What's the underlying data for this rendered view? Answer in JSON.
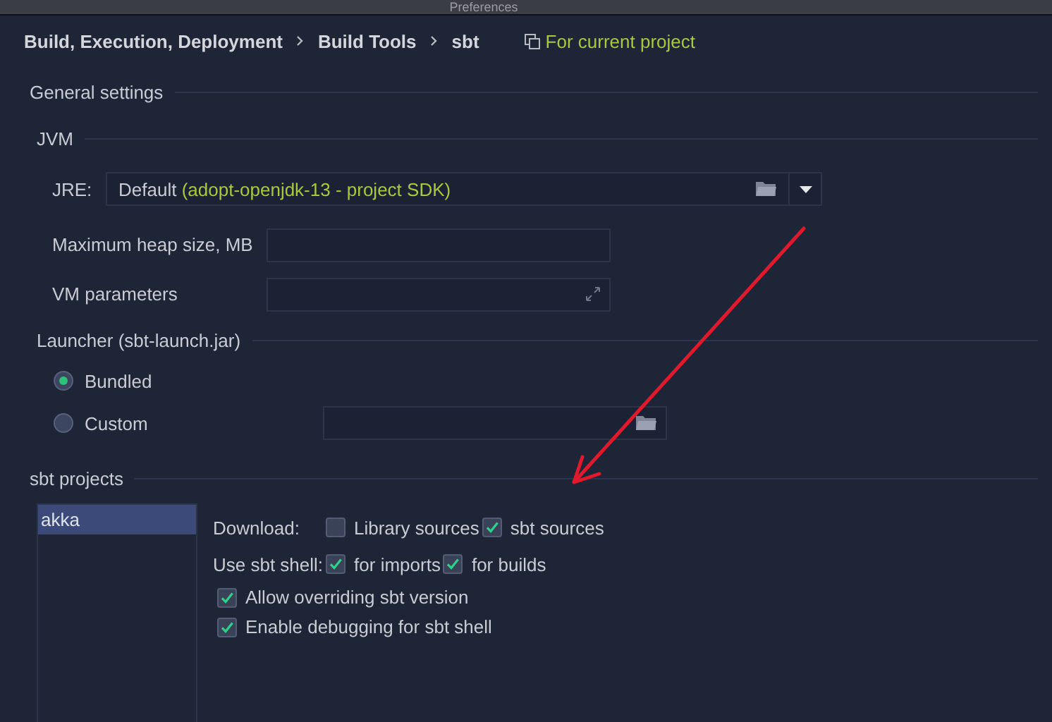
{
  "window": {
    "title": "Preferences"
  },
  "breadcrumb": [
    "Build, Execution, Deployment",
    "Build Tools",
    "sbt"
  ],
  "scope": "For current project",
  "general": {
    "title": "General settings"
  },
  "jvm": {
    "title": "JVM",
    "jre_label": "JRE:",
    "jre_value": "Default",
    "jre_detail": "(adopt-openjdk-13 - project SDK)",
    "heap_label": "Maximum heap size, MB",
    "vm_label": "VM parameters"
  },
  "launcher": {
    "title": "Launcher (sbt-launch.jar)",
    "options": [
      {
        "label": "Bundled",
        "selected": true
      },
      {
        "label": "Custom",
        "selected": false
      }
    ]
  },
  "sbt_projects": {
    "title": "sbt projects",
    "projects": [
      {
        "name": "akka",
        "selected": true
      }
    ],
    "download": {
      "label": "Download:",
      "options": [
        {
          "label": "Library sources",
          "checked": false
        },
        {
          "label": "sbt sources",
          "checked": true
        }
      ]
    },
    "shell": {
      "label": "Use sbt shell:",
      "options": [
        {
          "label": "for imports",
          "checked": true
        },
        {
          "label": "for builds",
          "checked": true
        }
      ]
    },
    "extra": [
      {
        "label": "Allow overriding sbt version",
        "checked": true
      },
      {
        "label": "Enable debugging for sbt shell",
        "checked": true
      }
    ]
  }
}
